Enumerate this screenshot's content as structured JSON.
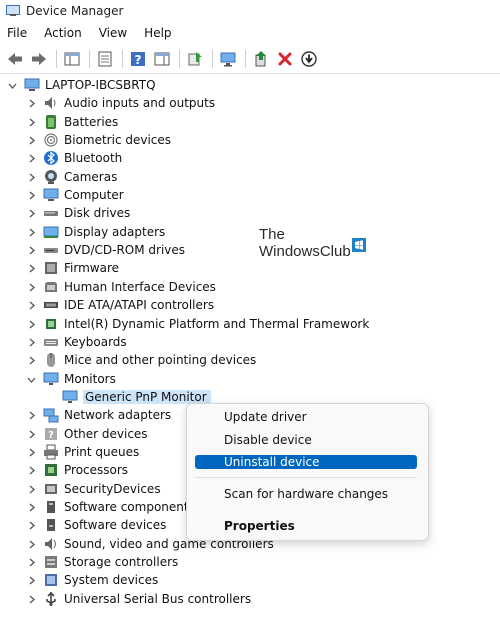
{
  "window": {
    "title": "Device Manager"
  },
  "menu": [
    "File",
    "Action",
    "View",
    "Help"
  ],
  "tree": {
    "root": "LAPTOP-IBCSBRTQ",
    "categories": [
      {
        "label": "Audio inputs and outputs",
        "icon": "speaker-icon"
      },
      {
        "label": "Batteries",
        "icon": "battery-icon"
      },
      {
        "label": "Biometric devices",
        "icon": "fingerprint-icon"
      },
      {
        "label": "Bluetooth",
        "icon": "bluetooth-icon"
      },
      {
        "label": "Cameras",
        "icon": "camera-icon"
      },
      {
        "label": "Computer",
        "icon": "computer-icon"
      },
      {
        "label": "Disk drives",
        "icon": "disk-drive-icon"
      },
      {
        "label": "Display adapters",
        "icon": "display-adapter-icon"
      },
      {
        "label": "DVD/CD-ROM drives",
        "icon": "dvd-drive-icon"
      },
      {
        "label": "Firmware",
        "icon": "firmware-icon"
      },
      {
        "label": "Human Interface Devices",
        "icon": "hid-icon"
      },
      {
        "label": "IDE ATA/ATAPI controllers",
        "icon": "ide-controller-icon"
      },
      {
        "label": "Intel(R) Dynamic Platform and Thermal Framework",
        "icon": "chip-icon"
      },
      {
        "label": "Keyboards",
        "icon": "keyboard-icon"
      },
      {
        "label": "Mice and other pointing devices",
        "icon": "mouse-icon"
      },
      {
        "label": "Monitors",
        "icon": "monitor-icon",
        "expanded": true
      },
      {
        "label": "Network adapters",
        "icon": "network-icon"
      },
      {
        "label": "Other devices",
        "icon": "other-devices-icon"
      },
      {
        "label": "Print queues",
        "icon": "printer-icon"
      },
      {
        "label": "Processors",
        "icon": "processor-icon"
      },
      {
        "label": "SecurityDevices",
        "icon": "security-icon"
      },
      {
        "label": "Software components",
        "icon": "software-component-icon"
      },
      {
        "label": "Software devices",
        "icon": "software-device-icon"
      },
      {
        "label": "Sound, video and game controllers",
        "icon": "sound-icon"
      },
      {
        "label": "Storage controllers",
        "icon": "storage-icon"
      },
      {
        "label": "System devices",
        "icon": "system-icon"
      },
      {
        "label": "Universal Serial Bus controllers",
        "icon": "usb-icon"
      }
    ],
    "monitor_child": "Generic PnP Monitor"
  },
  "context_menu": {
    "update": "Update driver",
    "disable": "Disable device",
    "uninstall": "Uninstall device",
    "scan": "Scan for hardware changes",
    "properties": "Properties"
  },
  "watermark": {
    "line1": "The",
    "line2": "WindowsClub"
  },
  "colors": {
    "selection": "#cce4f7",
    "highlight": "#0067c0",
    "remove": "#d9232d",
    "update": "#1f8a3a"
  }
}
